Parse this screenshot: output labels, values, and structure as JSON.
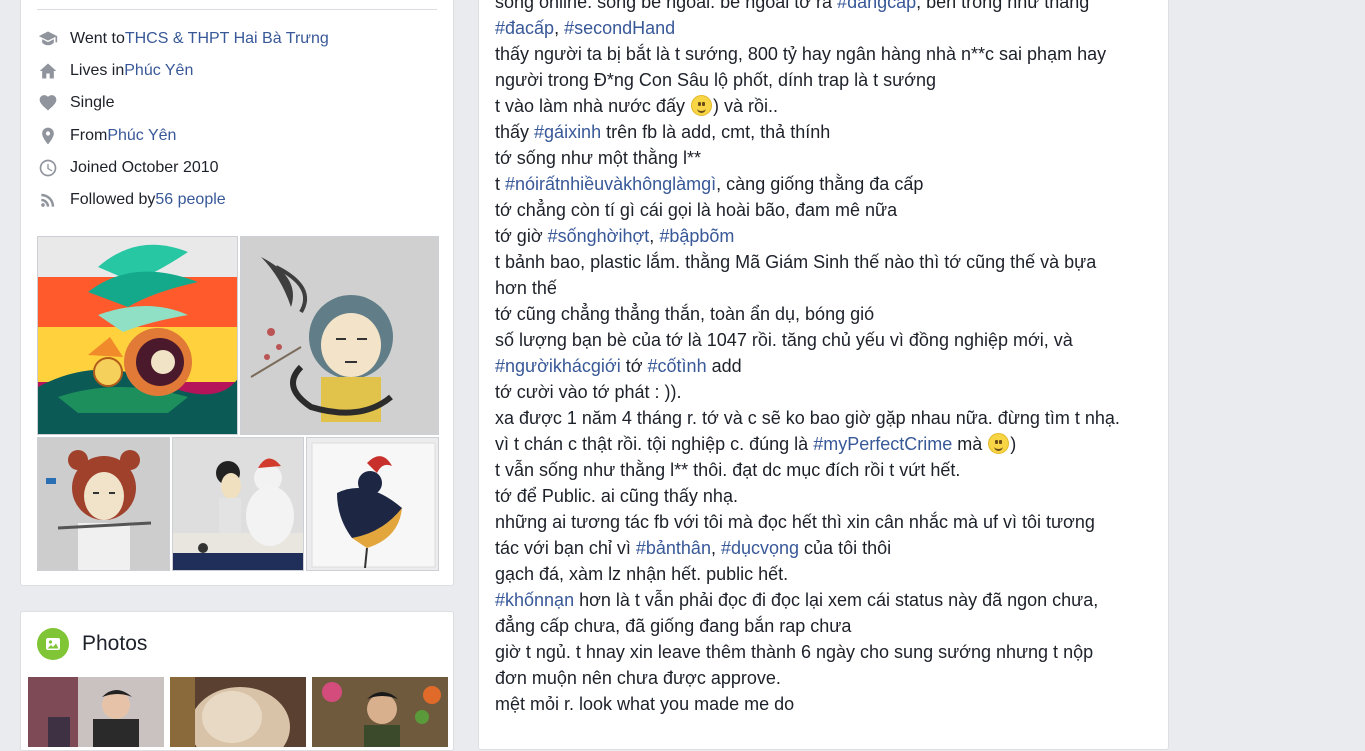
{
  "intro": {
    "items": [
      {
        "icon": "graduation-cap-icon",
        "prefix": "Went to ",
        "link": "THCS & THPT Hai Bà Trưng"
      },
      {
        "icon": "home-icon",
        "prefix": "Lives in ",
        "link": "Phúc Yên"
      },
      {
        "icon": "heart-icon",
        "prefix": "Single",
        "link": ""
      },
      {
        "icon": "location-pin-icon",
        "prefix": "From ",
        "link": "Phúc Yên"
      },
      {
        "icon": "clock-icon",
        "prefix": "Joined October 2010",
        "link": ""
      },
      {
        "icon": "rss-icon",
        "prefix": "Followed by ",
        "link": "56 people"
      }
    ]
  },
  "photos": {
    "title": "Photos",
    "icon": "photo-icon"
  },
  "post": {
    "lines": [
      [
        {
          "t": "sống online. sống bề ngoài. bề ngoài tớ ra "
        },
        {
          "h": "#đẳngcấp"
        },
        {
          "t": ", bên trong như thằng"
        }
      ],
      [
        {
          "h": "#đacấp"
        },
        {
          "t": ", "
        },
        {
          "h": "#secondHand"
        }
      ],
      [
        {
          "t": "thấy người ta bị bắt là t sướng, 800 tỷ hay ngân hàng nhà n**c sai phạm hay"
        }
      ],
      [
        {
          "t": "người trong Đ*ng Con Sâu lộ phốt, dính trap là t sướng"
        }
      ],
      [
        {
          "t": "t vào làm nhà nước đấy "
        },
        {
          "e": "smile"
        },
        {
          "t": ") và rồi.."
        }
      ],
      [
        {
          "t": "thấy "
        },
        {
          "h": "#gáixinh"
        },
        {
          "t": " trên fb là add, cmt, thả thính"
        }
      ],
      [
        {
          "t": "tớ sống như một thằng l**"
        }
      ],
      [
        {
          "t": "t "
        },
        {
          "h": "#nóirấtnhiềuvàkhônglàmgì"
        },
        {
          "t": ", càng giống thằng đa cấp"
        }
      ],
      [
        {
          "t": "tớ chẳng còn tí gì cái gọi là hoài bão, đam mê nữa"
        }
      ],
      [
        {
          "t": "tớ giờ "
        },
        {
          "h": "#sốnghờihợt"
        },
        {
          "t": ", "
        },
        {
          "h": "#bậpbõm"
        }
      ],
      [
        {
          "t": "t bảnh bao, plastic lắm. thằng Mã Giám Sinh thế nào thì tớ cũng thế và bựa"
        }
      ],
      [
        {
          "t": "hơn thế"
        }
      ],
      [
        {
          "t": "tớ cũng chẳng thẳng thắn, toàn ẩn dụ, bóng gió"
        }
      ],
      [
        {
          "t": "số lượng bạn bè của tớ là 1047 rồi. tăng chủ yếu vì đồng nghiệp mới, và"
        }
      ],
      [
        {
          "h": "#ngườikhácgiới"
        },
        {
          "t": " tớ "
        },
        {
          "h": "#cốtình"
        },
        {
          "t": " add"
        }
      ],
      [
        {
          "t": "tớ cười vào tớ phát : ))."
        }
      ],
      [
        {
          "t": "xa được 1 năm 4 tháng r. tớ và c sẽ ko bao giờ gặp nhau nữa. đừng tìm t nhạ."
        }
      ],
      [
        {
          "t": "vì t chán c thật rồi. tội nghiệp c. đúng là "
        },
        {
          "h": "#myPerfectCrime"
        },
        {
          "t": " mà "
        },
        {
          "e": "smile"
        },
        {
          "t": ")"
        }
      ],
      [
        {
          "t": "t vẫn sống như thằng l** thôi. đạt dc mục đích rồi t vứt hết."
        }
      ],
      [
        {
          "t": "tớ để Public. ai cũng thấy nhạ."
        }
      ],
      [
        {
          "t": "những ai tương tác fb với tôi mà đọc hết thì xin cân nhắc mà uf vì tôi tương"
        }
      ],
      [
        {
          "t": "tác với bạn chỉ vì "
        },
        {
          "h": "#bảnthân"
        },
        {
          "t": ", "
        },
        {
          "h": "#dụcvọng"
        },
        {
          "t": " của tôi thôi"
        }
      ],
      [
        {
          "t": "gạch đá, xàm lz nhận hết. public hết."
        }
      ],
      [
        {
          "h": "#khốnnạn"
        },
        {
          "t": " hơn là t vẫn phải đọc đi đọc lại xem cái status này đã ngon chưa,"
        }
      ],
      [
        {
          "t": "đẳng cấp chưa, đã giống đang bắn rap chưa"
        }
      ],
      [
        {
          "t": "giờ t ngủ. t hnay xin leave thêm thành 6 ngày cho sung sướng nhưng t nộp"
        }
      ],
      [
        {
          "t": "đơn muộn nên chưa được approve."
        }
      ],
      [
        {
          "t": "mệt mỏi r. look what you made me do"
        }
      ]
    ]
  }
}
